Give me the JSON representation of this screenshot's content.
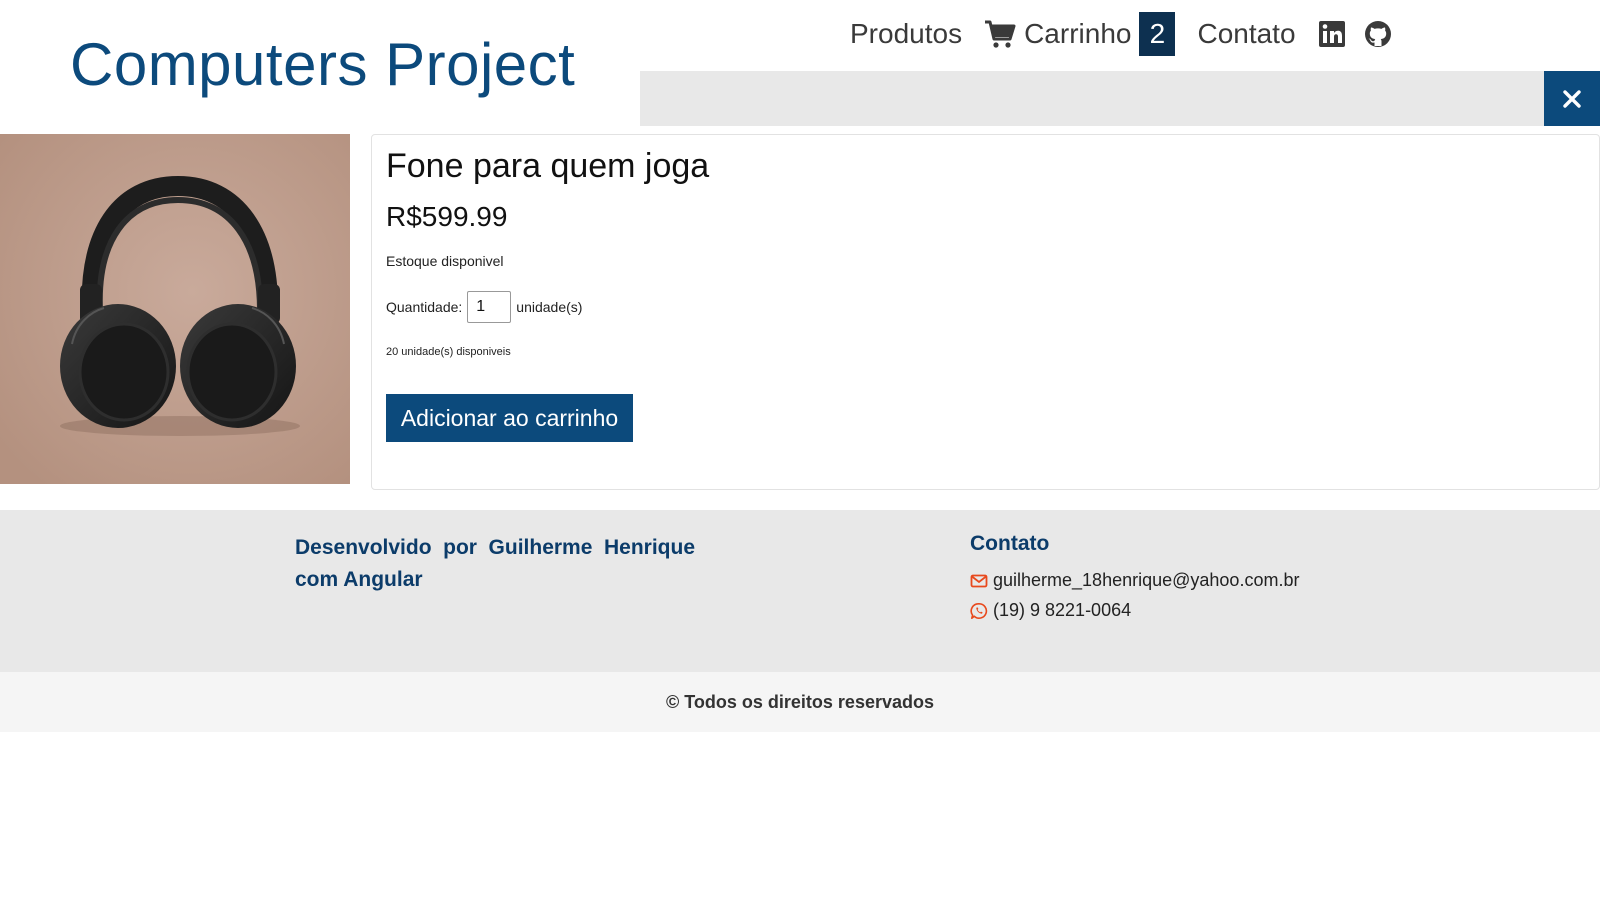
{
  "header": {
    "brand": "Computers Project",
    "nav": {
      "products": "Produtos",
      "cart": "Carrinho",
      "cart_count": "2",
      "contact": "Contato"
    },
    "icons": [
      "cart-icon",
      "linkedin-icon",
      "github-icon",
      "close-icon"
    ],
    "search": {
      "value": "",
      "placeholder": ""
    }
  },
  "product": {
    "title": "Fone para quem joga",
    "price": "R$599.99",
    "stock_status": "Estoque disponivel",
    "quantity_label": "Quantidade:",
    "quantity_value": "1",
    "quantity_unit": "unidade(s)",
    "available_units": "20 unidade(s) disponiveis",
    "add_to_cart_label": "Adicionar ao carrinho"
  },
  "footer": {
    "developed_by": "Desenvolvido por Guilherme Henrique com Angular",
    "contact_title": "Contato",
    "email": "guilherme_18henrique@yahoo.com.br",
    "phone": "(19) 9 8221-0064",
    "copyright": "© Todos os direitos reservados"
  },
  "colors": {
    "brand_blue": "#0c4a7c",
    "badge_dark": "#0d3050",
    "footer_bg": "#e8e8e8",
    "accent_orange": "#e8491d"
  }
}
